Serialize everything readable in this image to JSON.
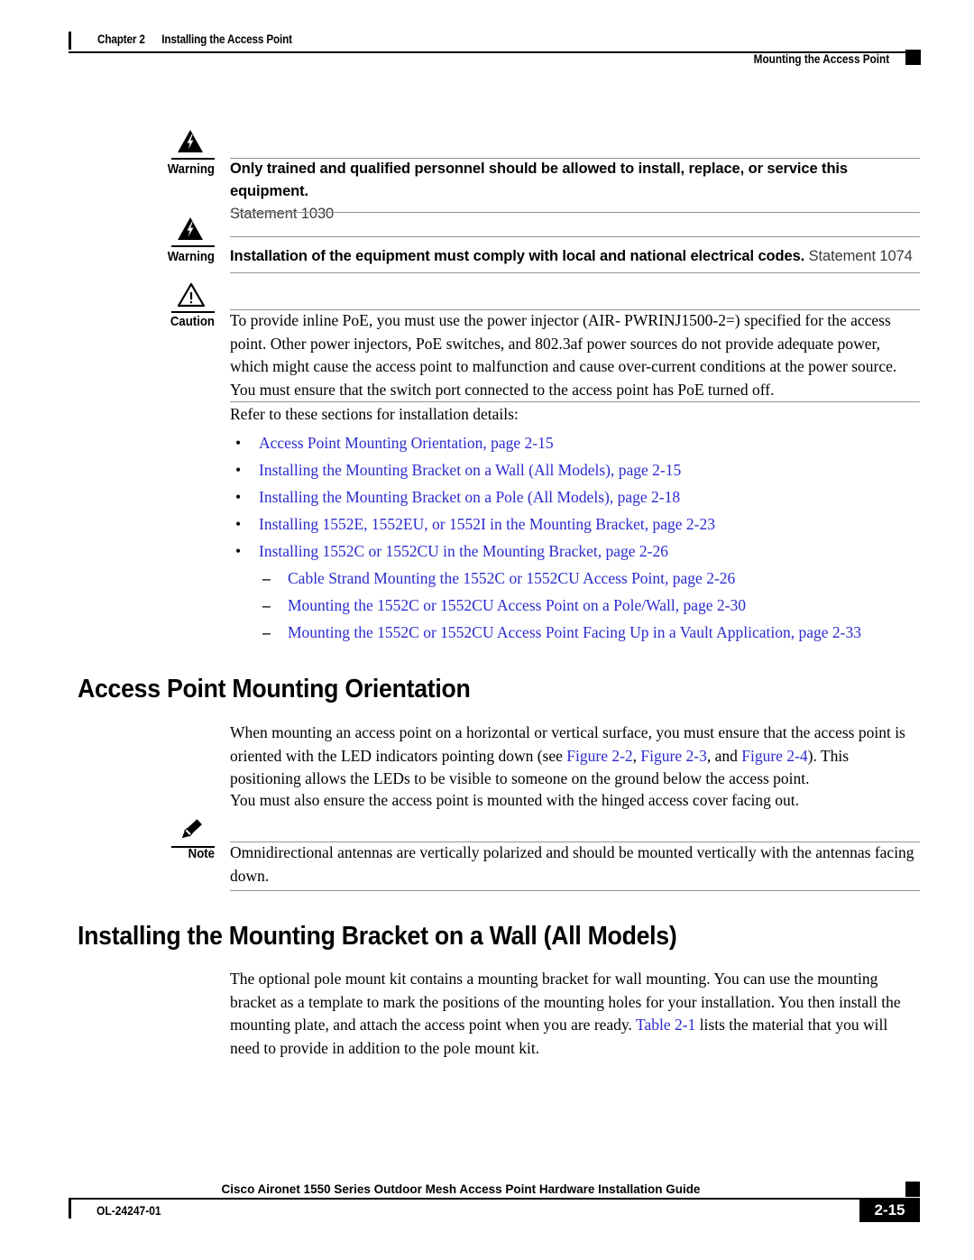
{
  "header": {
    "chapter": "Chapter 2",
    "chapter_title": "Installing the Access Point",
    "running_head": "Mounting the Access Point"
  },
  "admonitions": [
    {
      "kind": "warning",
      "icon": "warning-lightning-triangle-icon",
      "label": "Warning",
      "bold_text": "Only trained and qualified personnel should be allowed to install, replace, or service this equipment.",
      "plain_text": "Statement 1030"
    },
    {
      "kind": "warning",
      "icon": "warning-lightning-triangle-icon",
      "label": "Warning",
      "bold_text": "Installation of the equipment must comply with local and national electrical codes.",
      "plain_text": "Statement 1074"
    },
    {
      "kind": "caution",
      "icon": "caution-exclamation-triangle-icon",
      "label": "Caution",
      "body": "To provide inline PoE, you must use the power injector (AIR- PWRINJ1500-2=) specified for the access point. Other power injectors, PoE switches, and 802.3af power sources do not provide adequate power, which might cause the access point to malfunction and cause over-current conditions at the power source. You must ensure that the switch port connected to the access point has PoE turned off."
    },
    {
      "kind": "note",
      "icon": "note-pencil-icon",
      "label": "Note",
      "body": "Omnidirectional antennas are vertically polarized and should be mounted vertically with the antennas facing down."
    }
  ],
  "intro": {
    "lead": "Refer to these sections for installation details:",
    "bullet_marker": "•",
    "dash_marker": "–",
    "links": [
      "Access Point Mounting Orientation, page 2-15",
      "Installing the Mounting Bracket on a Wall (All Models), page 2-15",
      "Installing the Mounting Bracket on a Pole (All Models), page 2-18",
      "Installing 1552E, 1552EU, or 1552I in the Mounting Bracket, page 2-23",
      "Installing 1552C or 1552CU in the Mounting Bracket, page 2-26"
    ],
    "sublinks": [
      "Cable Strand Mounting the 1552C or 1552CU Access Point, page 2-26",
      "Mounting the 1552C or 1552CU Access Point on a Pole/Wall, page 2-30",
      "Mounting the 1552C or 1552CU Access Point Facing Up in a Vault Application, page 2-33"
    ]
  },
  "section1": {
    "heading": "Access Point Mounting Orientation",
    "para1_a": "When mounting an access point on a horizontal or vertical surface, you must ensure that the access point is oriented with the LED indicators pointing down (see ",
    "para1_link1": "Figure 2-2",
    "para1_b": ", ",
    "para1_link2": "Figure 2-3",
    "para1_c": ", and ",
    "para1_link3": "Figure 2-4",
    "para1_d": "). This positioning allows the LEDs to be visible to someone on the ground below the access point.",
    "para2": "You must also ensure the access point is mounted with the hinged access cover facing out."
  },
  "section2": {
    "heading": "Installing the Mounting Bracket on a Wall (All Models)",
    "para1_a": "The optional pole mount kit contains a mounting bracket for wall mounting. You can use the mounting bracket as a template to mark the positions of the mounting holes for your installation. You then install the mounting plate, and attach the access point when you are ready. ",
    "para1_link": "Table 2-1",
    "para1_b": " lists the material that you will need to provide in addition to the pole mount kit."
  },
  "footer": {
    "title": "Cisco Aironet 1550 Series Outdoor Mesh Access Point Hardware Installation Guide",
    "doc_id": "OL-24247-01",
    "page_number": "2-15"
  },
  "colors": {
    "link": "#2b2bcf",
    "rule": "#959595",
    "text": "#000000"
  }
}
